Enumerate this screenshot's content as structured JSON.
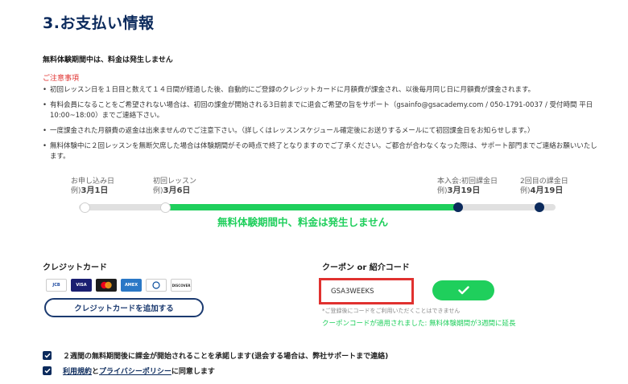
{
  "title": "3.お支払い情報",
  "trial_note": "無料体験期間中は、料金は発生しません",
  "caution_heading": "ご注意事項",
  "notes": [
    "初回レッスン日を１日目と数えて１４日間が経過した後、自動的にご登録のクレジットカードに月額費が課金され、以後毎月同じ日に月額費が課金されます。",
    "有料会員になることをご希望されない場合は、初回の課金が開始される3日前までに退会ご希望の旨をサポート（gsainfo@gsacademy.com / 050-1791-0037 / 受付時間 平日10:00~18:00）までご連絡下さい。",
    "一度課金された月額費の返金は出来ませんのでご注意下さい。（詳しくはレッスンスケジュール確定後にお送りするメールにて初回課金日をお知らせします。）",
    "無料体験中に２回レッスンを無断欠席した場合は体験期間がその時点で終了となりますのでご了承ください。ご都合が合わなくなった際は、サポート部門までご連絡お願いいたします。"
  ],
  "timeline": {
    "points": [
      {
        "label": "お申し込み日",
        "example": "例)",
        "date": "3月1日"
      },
      {
        "label": "初回レッスン",
        "example": "例)",
        "date": "3月6日"
      },
      {
        "label": "本入会:初回課金日",
        "example": "例)",
        "date": "3月19日"
      },
      {
        "label": "2回目の課金日",
        "example": "例)",
        "date": "4月19日"
      }
    ],
    "caption": "無料体験期間中、料金は発生しません"
  },
  "credit_card": {
    "heading": "クレジットカード",
    "brands": [
      {
        "name": "JCB",
        "icon": "jcb-icon",
        "color": "#1f4aa0"
      },
      {
        "name": "VISA",
        "icon": "visa-icon",
        "color": "#1a1f71"
      },
      {
        "name": "MC",
        "icon": "mastercard-icon",
        "color": "#f08a1c"
      },
      {
        "name": "AMEX",
        "icon": "amex-icon",
        "color": "#2a78c6"
      },
      {
        "name": "DC",
        "icon": "diners-club-icon",
        "color": "#ffffff"
      },
      {
        "name": "DISCOVER",
        "icon": "discover-icon",
        "color": "#ffffff"
      }
    ],
    "add_button": "クレジットカードを追加する"
  },
  "coupon": {
    "heading": "クーポン or 紹介コード",
    "value": "GSA3WEEKS",
    "note": "*ご登録後にコードをご利用いただくことはできません",
    "success": "クーポンコードが適用されました: 無料体験期間が3週間に延長"
  },
  "checkboxes": {
    "approve": "２週間の無料期間後に課金が開始されることを承諾します(退会する場合は、弊社サポートまで連絡)",
    "terms_link": "利用規約",
    "and": "と",
    "privacy_link": "プライバシーポリシー",
    "agree_suffix": "に同意します"
  },
  "colors": {
    "navy": "#0b2a5c",
    "green": "#1fcf5c",
    "red": "#e0312f"
  }
}
